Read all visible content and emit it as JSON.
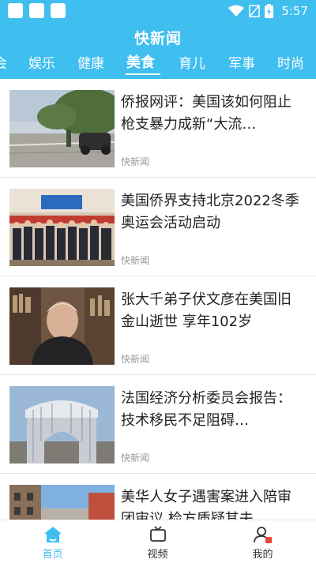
{
  "status_bar": {
    "time": "5:57"
  },
  "app": {
    "title": "快新闻"
  },
  "tabs": [
    {
      "label": "会",
      "active": false
    },
    {
      "label": "娱乐",
      "active": false
    },
    {
      "label": "健康",
      "active": false
    },
    {
      "label": "美食",
      "active": true
    },
    {
      "label": "育儿",
      "active": false
    },
    {
      "label": "军事",
      "active": false
    },
    {
      "label": "时尚",
      "active": false
    }
  ],
  "articles": [
    {
      "title": "侨报网评：美国该如何阻止枪支暴力成新“大流…",
      "source": "快新闻"
    },
    {
      "title": "美国侨界支持北京2022冬季奥运会活动启动",
      "source": "快新闻"
    },
    {
      "title": "张大千弟子伏文彦在美国旧金山逝世 享年102岁",
      "source": "快新闻"
    },
    {
      "title": "法国经济分析委员会报告：技术移民不足阻碍…",
      "source": "快新闻"
    },
    {
      "title": "美华人女子遇害案进入陪审团审议 检方质疑其夫",
      "source": ""
    }
  ],
  "bottom_nav": [
    {
      "label": "首页",
      "icon": "home-icon",
      "active": true
    },
    {
      "label": "视频",
      "icon": "video-icon",
      "active": false
    },
    {
      "label": "我的",
      "icon": "profile-icon",
      "active": false
    }
  ],
  "colors": {
    "accent": "#3fbef0",
    "text": "#222222",
    "meta": "#999999"
  }
}
